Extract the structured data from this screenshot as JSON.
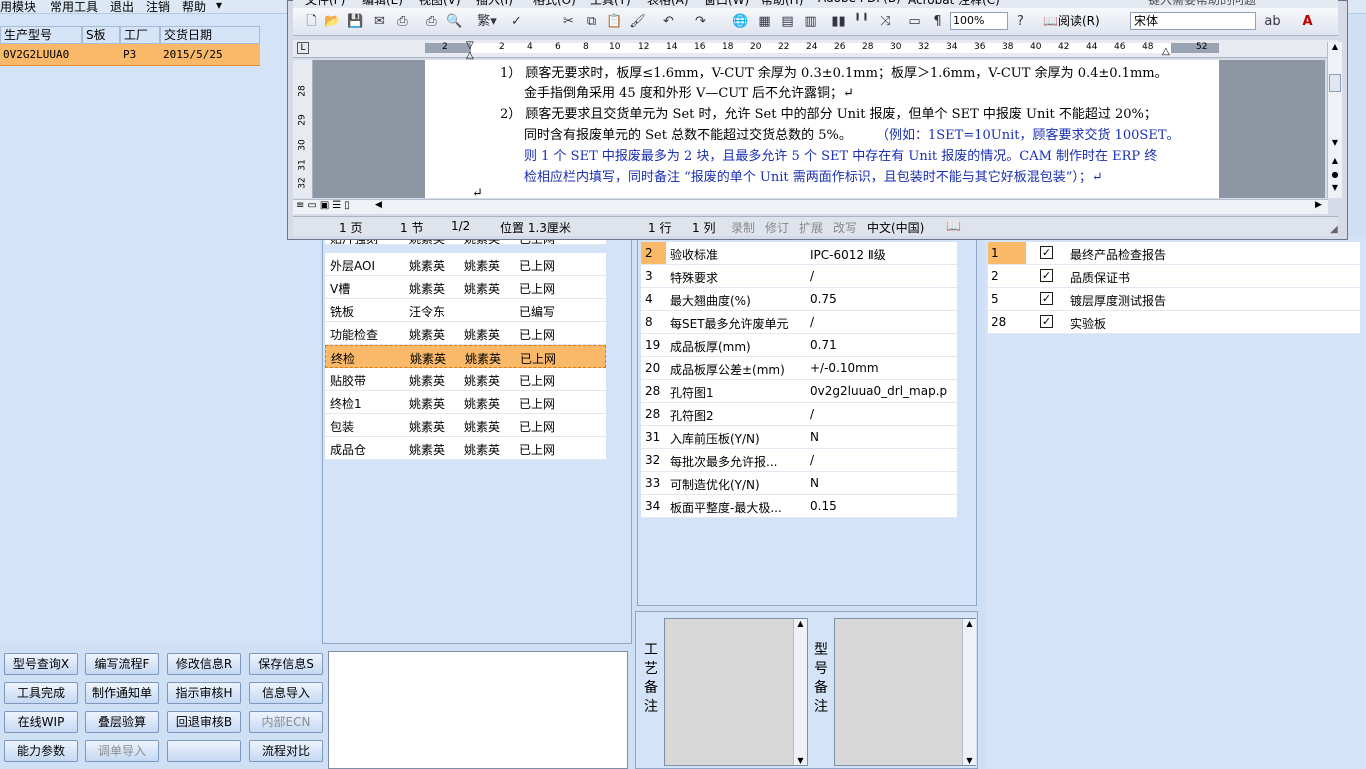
{
  "menubar": {
    "items": [
      "用模块",
      "常用工具",
      "退出",
      "注销",
      "帮助"
    ]
  },
  "order_table": {
    "headers": [
      "生产型号",
      "S板",
      "工厂",
      "交货日期"
    ],
    "row": [
      "0V2G2LUUA0",
      "",
      "P3",
      "2015/5/25"
    ]
  },
  "process_table": {
    "rows": [
      [
        "贴片强刻",
        "姚素英",
        "姚素英",
        "已上网"
      ],
      [
        "外层AOI",
        "姚素英",
        "姚素英",
        "已上网"
      ],
      [
        "V槽",
        "姚素英",
        "姚素英",
        "已上网"
      ],
      [
        "铣板",
        "汪令东",
        "",
        "已编写"
      ],
      [
        "功能检查",
        "姚素英",
        "姚素英",
        "已上网"
      ],
      [
        "终检",
        "姚素英",
        "姚素英",
        "已上网"
      ],
      [
        "贴胶带",
        "姚素英",
        "姚素英",
        "已上网"
      ],
      [
        "终检1",
        "姚素英",
        "姚素英",
        "已上网"
      ],
      [
        "包装",
        "姚素英",
        "姚素英",
        "已上网"
      ],
      [
        "成品仓",
        "姚素英",
        "姚素英",
        "已上网"
      ]
    ],
    "selected_index": 5
  },
  "spec_table": {
    "rows": [
      [
        "2",
        "验收标准",
        "IPC-6012 Ⅱ级"
      ],
      [
        "3",
        "特殊要求",
        "/"
      ],
      [
        "4",
        "最大翘曲度(%)",
        "0.75"
      ],
      [
        "8",
        "每SET最多允许废单元",
        "/"
      ],
      [
        "19",
        "成品板厚(mm)",
        "0.71"
      ],
      [
        "20",
        "成品板厚公差±(mm)",
        "+/-0.10mm"
      ],
      [
        "28",
        "孔符图1",
        "0v2g2luua0_drl_map.p"
      ],
      [
        "28",
        "孔符图2",
        "/"
      ],
      [
        "31",
        "入库前压板(Y/N)",
        "N"
      ],
      [
        "32",
        "每批次最多允许报...",
        "/"
      ],
      [
        "33",
        "可制造优化(Y/N)",
        "N"
      ],
      [
        "34",
        "板面平整度-最大极...",
        "0.15"
      ]
    ]
  },
  "report_table": {
    "rows": [
      [
        "1",
        "最终产品检查报告",
        true
      ],
      [
        "2",
        "品质保证书",
        true
      ],
      [
        "5",
        "镀层厚度测试报告",
        true
      ],
      [
        "28",
        "实验板",
        true
      ]
    ]
  },
  "notes": {
    "process_note_label": "工艺备注",
    "model_note_label": "型号备注"
  },
  "buttons": {
    "row1": [
      "型号查询X",
      "编写流程F",
      "修改信息R",
      "保存信息S"
    ],
    "row2": [
      "工具完成",
      "制作通知单",
      "指示审核H",
      "信息导入"
    ],
    "row3": [
      "在线WIP",
      "叠层验算",
      "回退审核B",
      "内部ECN"
    ],
    "row4": [
      "能力参数",
      "调单导入",
      "",
      "流程对比"
    ]
  },
  "word": {
    "menu_items": [
      "文件(F)",
      "编辑(E)",
      "视图(V)",
      "插入(I)",
      "格式(O)",
      "工具(T)",
      "表格(A)",
      "窗口(W)",
      "帮助(H)",
      "Adobe PDF(B)",
      "Acrobat 注释(C)"
    ],
    "zoom": "100%",
    "read_label": "阅读(R)",
    "font_name": "宋体",
    "help_search": "键入需要帮助的问题",
    "ruler_numbers": [
      "2",
      "2",
      "4",
      "6",
      "8",
      "10",
      "12",
      "14",
      "16",
      "18",
      "20",
      "22",
      "24",
      "26",
      "28",
      "30",
      "32",
      "34",
      "36",
      "38",
      "40",
      "42",
      "44",
      "46",
      "48",
      "52"
    ],
    "left_ruler_numbers": [
      "28",
      "29",
      "30",
      "31",
      "32"
    ],
    "doc_lines": [
      "1）  顾客无要求时，板厚≤1.6mm，V-CUT 余厚为 0.3±0.1mm；板厚＞1.6mm，V-CUT 余厚为 0.4±0.1mm。",
      "金手指倒角采用 45 度和外形 V—CUT 后不允许露铜；↵",
      "2）  顾客无要求且交货单元为 Set 时，允许 Set 中的部分 Unit 报废，但单个 SET 中报废 Unit 不能超过 20%；",
      "同时含有报废单元的 Set 总数不能超过交货总数的 5%。",
      "（例如：1SET=10Unit，顾客要求交货 100SET。",
      "则 1 个 SET 中报废最多为 2 块，且最多允许 5 个 SET 中存在有 Unit 报废的情况。CAM 制作时在 ERP 终",
      "检相应栏内填写，同时备注 “报废的单个 Unit 需两面作标识，且包装时不能与其它好板混包装”）；↵",
      "↵"
    ],
    "status": {
      "page": "1 页",
      "section": "1 节",
      "page_of": "1/2",
      "position": "位置 1.3厘米",
      "line": "1 行",
      "column": "1 列",
      "rec": "录制",
      "trk": "修订",
      "ext": "扩展",
      "ovr": "改写",
      "lang": "中文(中国)"
    }
  },
  "colors": {
    "selection": "#f9b969",
    "panel": "#d4e3f7",
    "doc_blue": "#1a2fb3"
  }
}
